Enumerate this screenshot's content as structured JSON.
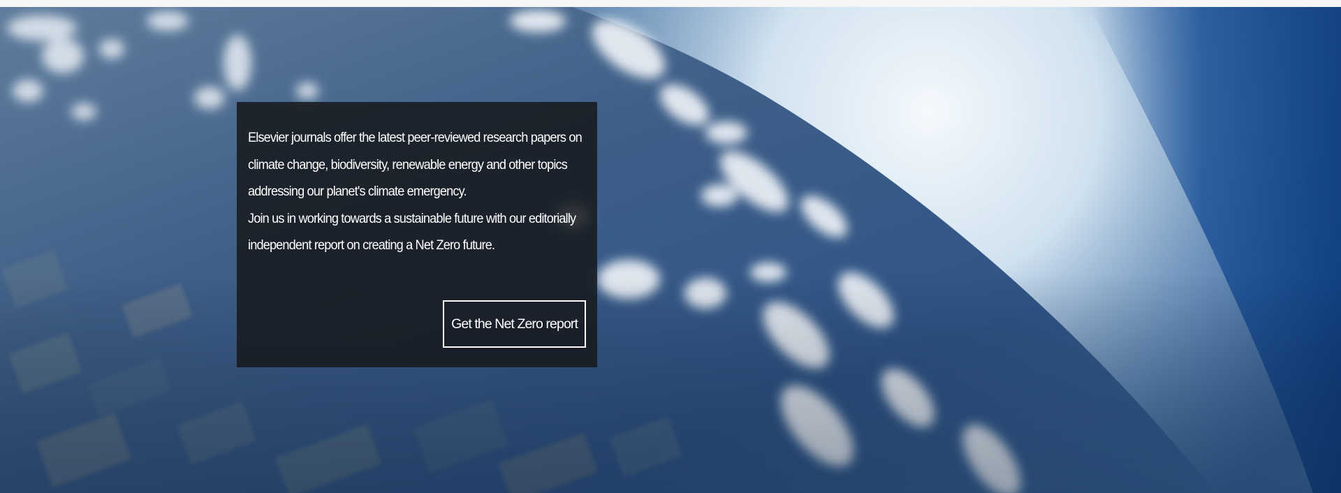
{
  "hero": {
    "background_image": "earth-from-orbit-with-clouds",
    "colors": {
      "panel_background": "#16181c",
      "text": "#ffffff",
      "button_border": "#ffffff",
      "sky_deep": "#0d3f85",
      "glow": "#f4f8fb"
    },
    "panel": {
      "lines": [
        "Elsevier journals offer the latest peer-reviewed research papers on",
        "climate change, biodiversity, renewable energy and other topics",
        "addressing our planet's climate emergency.",
        "Join us in working towards a sustainable future with our editorially",
        "independent report on creating a Net Zero future."
      ],
      "button_label": "Get the Net Zero report"
    }
  }
}
